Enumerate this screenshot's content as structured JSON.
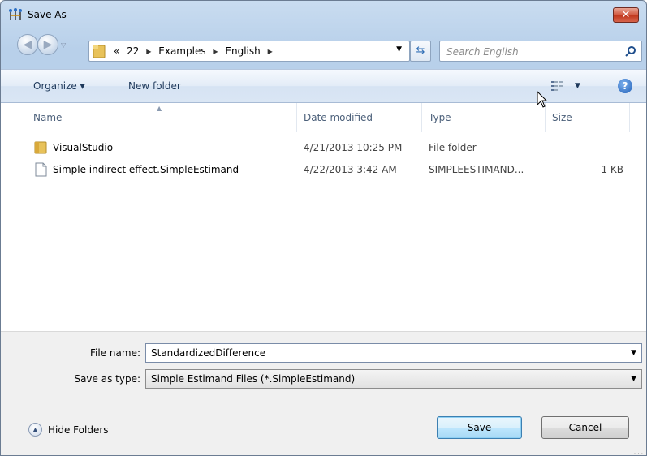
{
  "window": {
    "title": "Save As",
    "close_label": "✕"
  },
  "nav": {
    "breadcrumb": [
      "«",
      "22",
      "Examples",
      "English"
    ],
    "search_placeholder": "Search English"
  },
  "toolbar": {
    "organize_label": "Organize ▾",
    "new_folder_label": "New folder",
    "help_label": "?"
  },
  "columns": {
    "name": "Name",
    "date": "Date modified",
    "type": "Type",
    "size": "Size"
  },
  "files": [
    {
      "name": "VisualStudio",
      "date": "4/21/2013 10:25 PM",
      "type": "File folder",
      "size": "",
      "icon": "folder-icon"
    },
    {
      "name": "Simple indirect effect.SimpleEstimand",
      "date": "4/22/2013 3:42 AM",
      "type": "SIMPLEESTIMAND...",
      "size": "1 KB",
      "icon": "file-icon"
    }
  ],
  "form": {
    "file_name_label": "File name:",
    "file_name_value": "StandardizedDifference",
    "save_type_label": "Save as type:",
    "save_type_value": "Simple Estimand Files (*.SimpleEstimand)"
  },
  "footer": {
    "hide_folders_label": "Hide Folders",
    "save_label": "Save",
    "cancel_label": "Cancel"
  },
  "colors": {
    "accent": "#1e395b",
    "folder": "#e8c25a",
    "close": "#c0361c"
  }
}
